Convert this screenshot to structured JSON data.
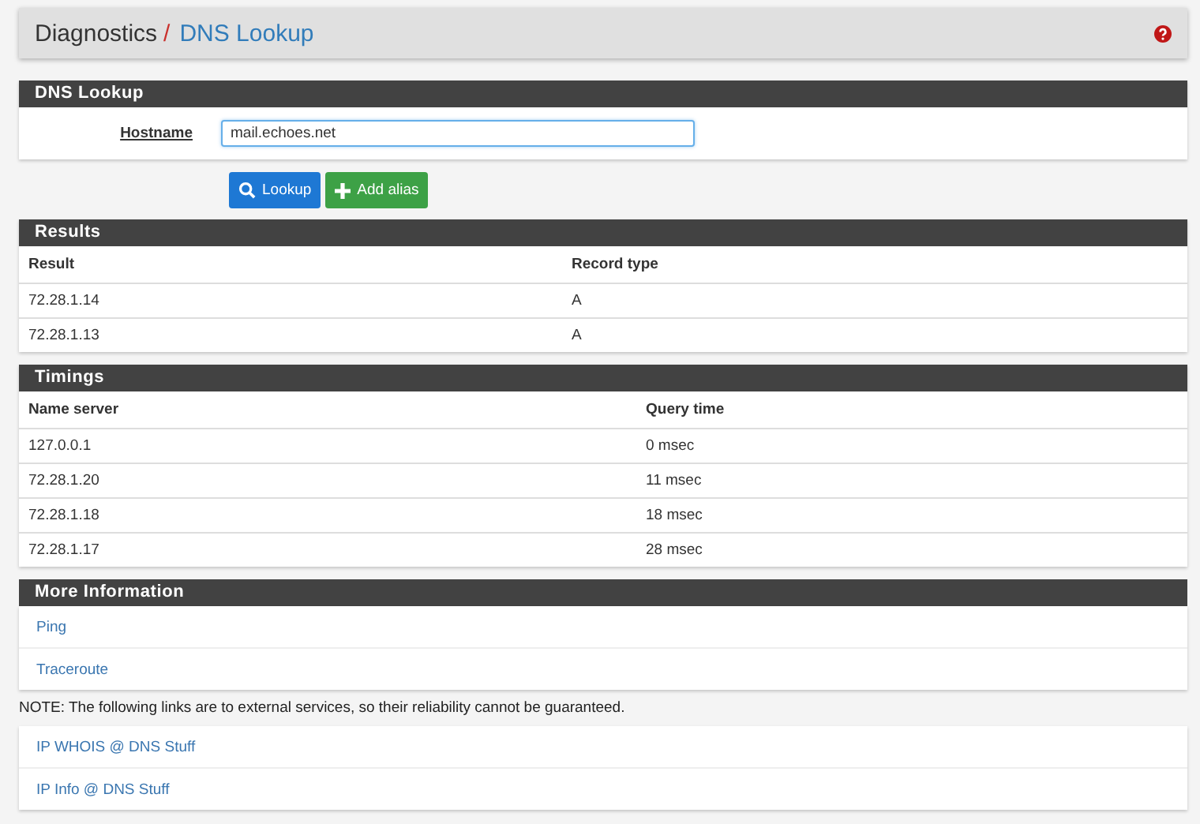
{
  "breadcrumb": {
    "section": "Diagnostics",
    "separator": "/",
    "page": "DNS Lookup"
  },
  "lookup_panel": {
    "title": "DNS Lookup",
    "hostname_label": "Hostname",
    "hostname_value": "mail.echoes.net"
  },
  "buttons": [
    {
      "label": "Lookup",
      "kind": "search"
    },
    {
      "label": "Add alias",
      "kind": "add"
    }
  ],
  "results": {
    "title": "Results",
    "columns": [
      "Result",
      "Record type"
    ],
    "rows": [
      [
        "72.28.1.14",
        "A"
      ],
      [
        "72.28.1.13",
        "A"
      ]
    ]
  },
  "timings": {
    "title": "Timings",
    "columns": [
      "Name server",
      "Query time"
    ],
    "rows": [
      [
        "127.0.0.1",
        "0 msec"
      ],
      [
        "72.28.1.20",
        "11 msec"
      ],
      [
        "72.28.1.18",
        "18 msec"
      ],
      [
        "72.28.1.17",
        "28 msec"
      ]
    ]
  },
  "more_information": {
    "title": "More Information",
    "links": [
      "Ping",
      "Traceroute"
    ],
    "note": "NOTE: The following links are to external services, so their reliability cannot be guaranteed.",
    "external_links": [
      "IP WHOIS @ DNS Stuff",
      "IP Info @ DNS Stuff"
    ]
  }
}
